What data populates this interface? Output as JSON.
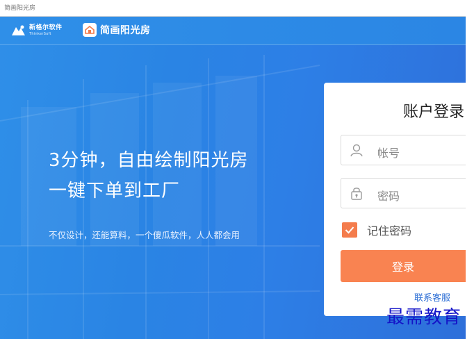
{
  "window": {
    "title": "简画阳光房"
  },
  "header": {
    "brand_cn": "新格尔软件",
    "brand_en": "ThinkerSoft",
    "product_name": "简画阳光房",
    "product_icon": "house-icon"
  },
  "hero": {
    "line1": "3分钟，自由绘制阳光房",
    "line2": "一键下单到工厂",
    "subtitle": "不仅设计，还能算料，一个傻瓜软件，人人都会用"
  },
  "login": {
    "title": "账户登录",
    "username_placeholder": "帐号",
    "password_placeholder": "密码",
    "remember_label": "记住密码",
    "remember_checked": true,
    "submit_label": "登录",
    "support_link": "联系客服"
  },
  "watermark": "最需教育",
  "colors": {
    "accent": "#f98351",
    "brand_blue": "#2f8fe8",
    "link": "#2d6fd6",
    "watermark": "#1414c8"
  }
}
